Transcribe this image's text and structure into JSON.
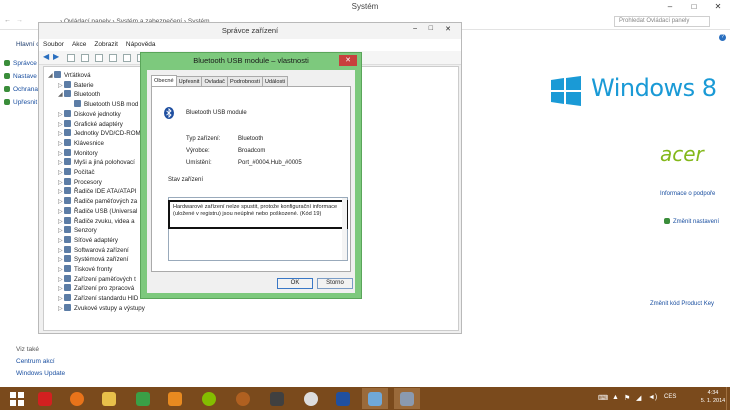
{
  "main_window": {
    "title": "Systém",
    "minimize": "–",
    "maximize": "□",
    "close": "✕",
    "breadcrumb": "› Ovládací panely › Systém a zabezpečení › Systém",
    "search_placeholder": "Prohledat Ovládací panely",
    "left_heading": "Hlavní o",
    "left_links": [
      "Správce",
      "Nastave",
      "Ochrana",
      "Upřesnit"
    ],
    "see_also": "Viz také",
    "bottom_links": [
      "Centrum akcí",
      "Windows Update"
    ],
    "windows8_text": "Windows 8",
    "acer_text": "acer",
    "right_links": {
      "support": "Informace o podpoře",
      "change_settings": "Změnit nastavení",
      "product_key": "Změnit kód Product Key"
    }
  },
  "device_manager": {
    "title": "Správce zařízení",
    "menu": [
      "Soubor",
      "Akce",
      "Zobrazit",
      "Nápověda"
    ],
    "tree": [
      {
        "label": "Vrťátková",
        "arrow": "◢",
        "level": 0
      },
      {
        "label": "Baterie",
        "arrow": "▷",
        "level": 1
      },
      {
        "label": "Bluetooth",
        "arrow": "◢",
        "level": 1
      },
      {
        "label": "Bluetooth USB mod",
        "arrow": "",
        "level": 2
      },
      {
        "label": "Diskové jednotky",
        "arrow": "▷",
        "level": 1
      },
      {
        "label": "Grafické adaptéry",
        "arrow": "▷",
        "level": 1
      },
      {
        "label": "Jednotky DVD/CD-ROM",
        "arrow": "▷",
        "level": 1
      },
      {
        "label": "Klávesnice",
        "arrow": "▷",
        "level": 1
      },
      {
        "label": "Monitory",
        "arrow": "▷",
        "level": 1
      },
      {
        "label": "Myši a jiná polohovací",
        "arrow": "▷",
        "level": 1
      },
      {
        "label": "Počítač",
        "arrow": "▷",
        "level": 1
      },
      {
        "label": "Procesory",
        "arrow": "▷",
        "level": 1
      },
      {
        "label": "Řadiče IDE ATA/ATAPI",
        "arrow": "▷",
        "level": 1
      },
      {
        "label": "Řadiče paměťových za",
        "arrow": "▷",
        "level": 1
      },
      {
        "label": "Řadiče USB (Universal",
        "arrow": "▷",
        "level": 1
      },
      {
        "label": "Řadiče zvuku, videa a",
        "arrow": "▷",
        "level": 1
      },
      {
        "label": "Senzory",
        "arrow": "▷",
        "level": 1
      },
      {
        "label": "Síťové adaptéry",
        "arrow": "▷",
        "level": 1
      },
      {
        "label": "Softwarová zařízení",
        "arrow": "▷",
        "level": 1
      },
      {
        "label": "Systémová zařízení",
        "arrow": "▷",
        "level": 1
      },
      {
        "label": "Tiskové fronty",
        "arrow": "▷",
        "level": 1
      },
      {
        "label": "Zařízení paměťových t",
        "arrow": "▷",
        "level": 1
      },
      {
        "label": "Zařízení pro zpracová",
        "arrow": "▷",
        "level": 1
      },
      {
        "label": "Zařízení standardu HID",
        "arrow": "▷",
        "level": 1
      },
      {
        "label": "Zvukové vstupy a výstupy",
        "arrow": "▷",
        "level": 1
      }
    ]
  },
  "dialog": {
    "title": "Bluetooth USB module – vlastnosti",
    "close": "✕",
    "tabs": [
      "Obecné",
      "Upřesnit",
      "Ovladač",
      "Podrobnosti",
      "Události"
    ],
    "device_name": "Bluetooth USB module",
    "fields": [
      {
        "label": "Typ zařízení:",
        "value": "Bluetooth"
      },
      {
        "label": "Výrobce:",
        "value": "Broadcom"
      },
      {
        "label": "Umístění:",
        "value": "Port_#0004.Hub_#0005"
      }
    ],
    "status_label": "Stav zařízení",
    "status_text": "Hardwarové zařízení nelze spustit, protože konfigurační informace (uložené v registru) jsou neúplné nebo poškozené. (Kód 19)",
    "ok": "OK",
    "cancel": "Storno"
  },
  "taskbar": {
    "lang": "CES",
    "time": "4:34",
    "date": "5. 1. 2014"
  }
}
